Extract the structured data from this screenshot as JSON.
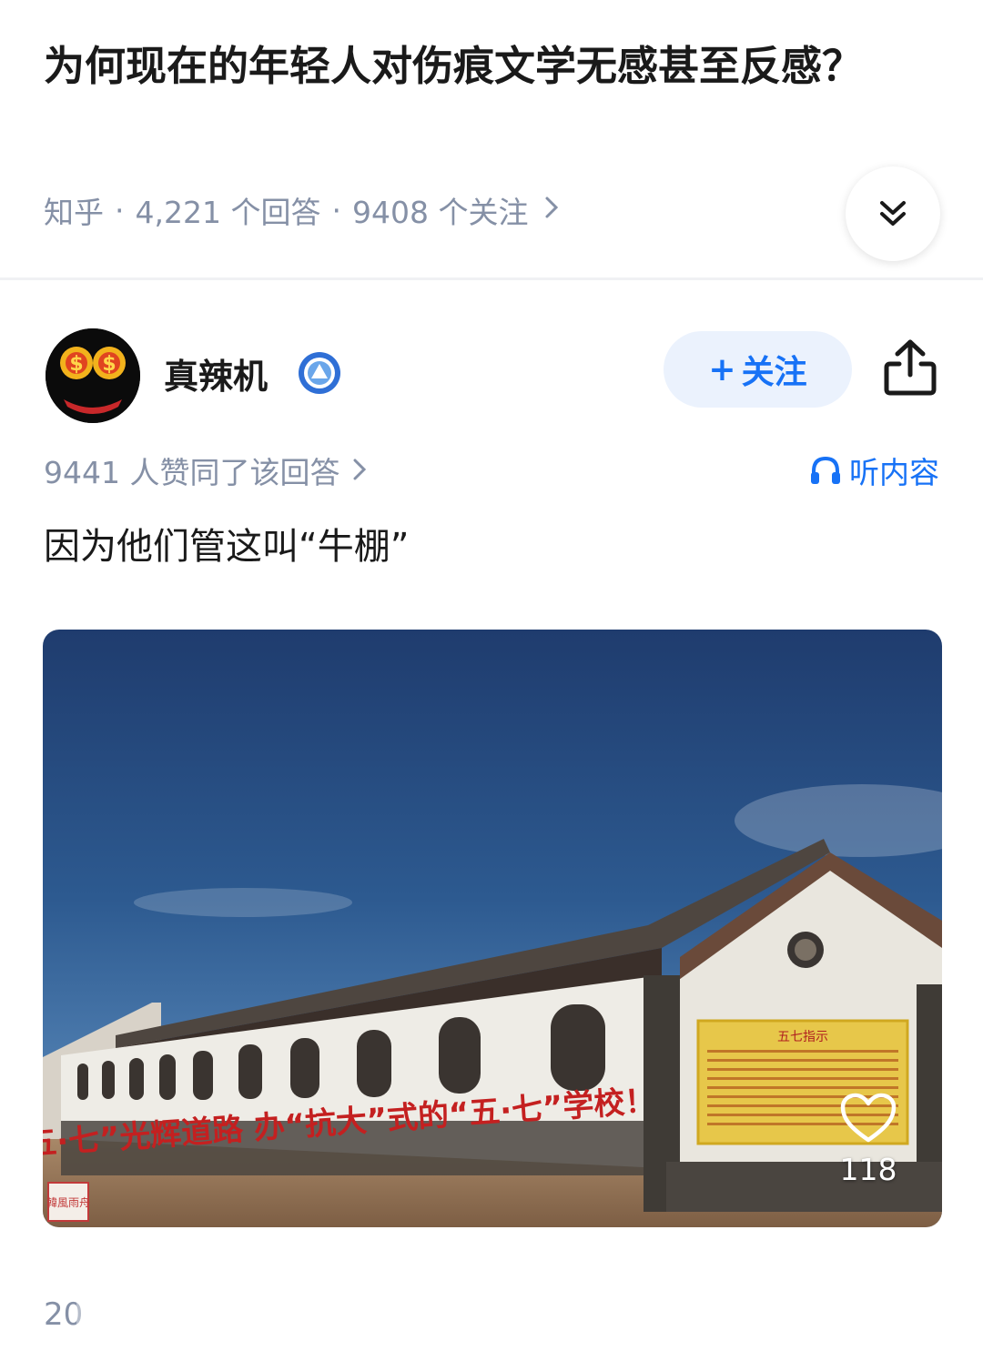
{
  "question": {
    "title": "为何现在的年轻人对伤痕文学无感甚至反感？",
    "source": "知乎",
    "answers": "4,221 个回答",
    "followers": "9408 个关注",
    "separator": "·"
  },
  "author": {
    "name": "真辣机",
    "follow_label": "关注",
    "follow_plus": "+"
  },
  "answer": {
    "upvote_text": "9441 人赞同了该回答",
    "listen_label": "听内容",
    "text": "因为他们管这叫“牛棚”",
    "image": {
      "wall_slogan": "走“五·七”光辉道路 办“抗大”式的“五·七”学校！",
      "sign_title": "五七指示",
      "stamp": "韓風雨舟"
    },
    "likes": "118",
    "date_partial": "20"
  },
  "icons": {
    "expand": "double-chevron-down-icon",
    "share": "share-icon",
    "headphones": "headphones-icon",
    "heart": "heart-icon",
    "verified": "verified-badge-icon"
  },
  "colors": {
    "accent": "#1772f6",
    "meta": "#8590a6",
    "follow_bg": "#ebf2fd"
  }
}
